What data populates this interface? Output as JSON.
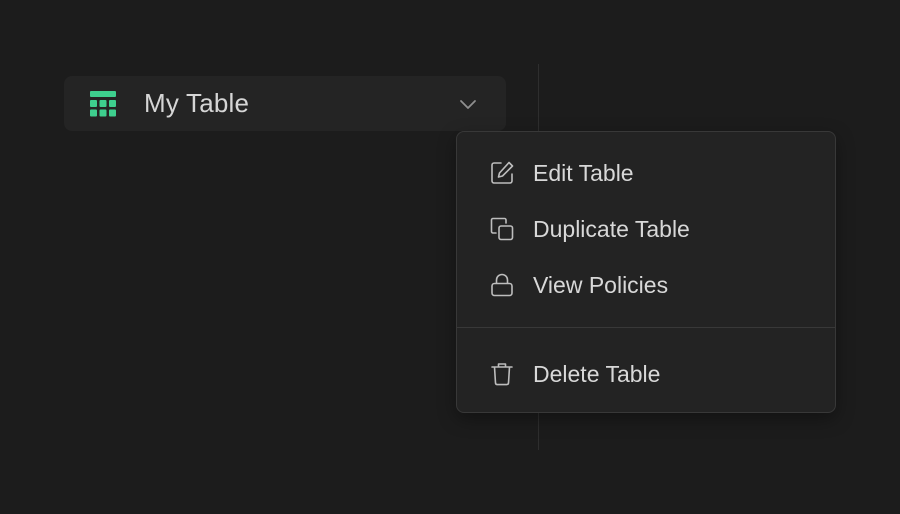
{
  "table": {
    "name": "My Table",
    "icon": "table-grid-icon",
    "icon_color": "#3ecf8e",
    "chevron_icon": "chevron-down-icon"
  },
  "menu": {
    "items": [
      {
        "label": "Edit Table",
        "icon": "edit-icon"
      },
      {
        "label": "Duplicate Table",
        "icon": "duplicate-icon"
      },
      {
        "label": "View Policies",
        "icon": "lock-icon"
      },
      {
        "label": "Delete Table",
        "icon": "trash-icon"
      }
    ]
  },
  "colors": {
    "background": "#1c1c1c",
    "item_background": "#242424",
    "menu_background": "#232323",
    "text": "#d8d8d8",
    "accent": "#3ecf8e"
  }
}
